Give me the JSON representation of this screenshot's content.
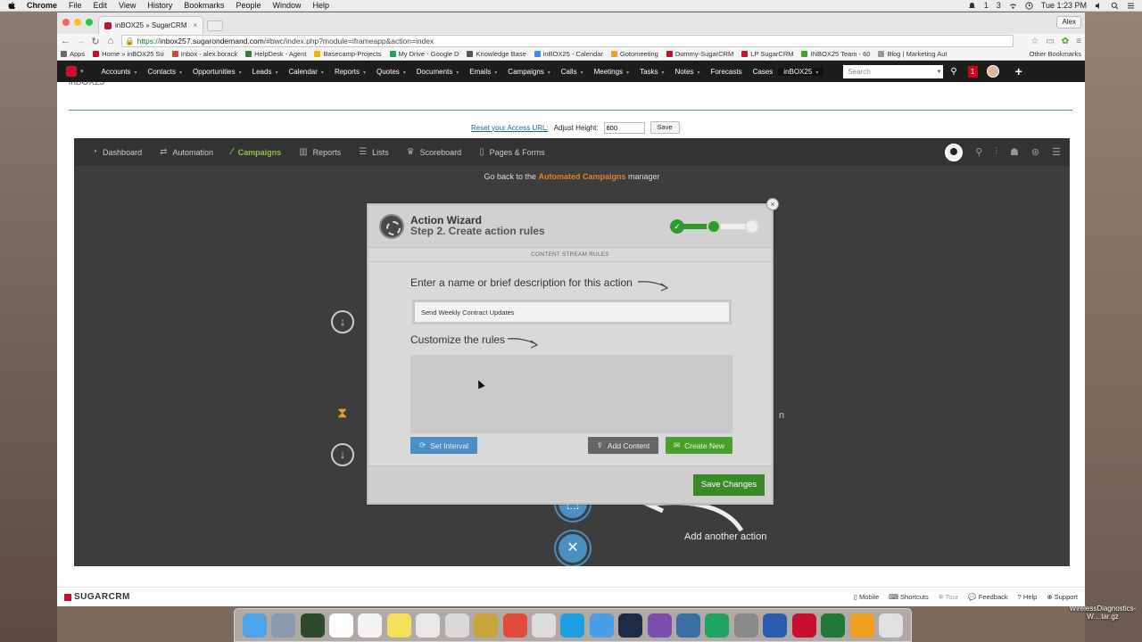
{
  "menubar": {
    "items": [
      "Chrome",
      "File",
      "Edit",
      "View",
      "History",
      "Bookmarks",
      "People",
      "Window",
      "Help"
    ],
    "battery_count": "1",
    "notif_count": "3",
    "clock": "Tue 1:23 PM"
  },
  "browser": {
    "tab_title": "inBOX25 » SugarCRM",
    "user": "Alex",
    "url_secure": "https://",
    "url_host": "inbox257.sugarondemand.com",
    "url_path": "/#bwc/index.php?module=iframeapp&action=index",
    "bookmarks": [
      {
        "label": "Apps",
        "color": "#6a6a6a"
      },
      {
        "label": "Home » inBOX25 Su",
        "color": "#c8102e"
      },
      {
        "label": "Inbox - alex.borack",
        "color": "#d44638"
      },
      {
        "label": "HelpDesk - Agent",
        "color": "#3a7a3a"
      },
      {
        "label": "Basecamp-Projects",
        "color": "#f5b400"
      },
      {
        "label": "My Drive - Google D",
        "color": "#1da462"
      },
      {
        "label": "Knowledge Base",
        "color": "#555555"
      },
      {
        "label": "inBOX25 - Calendar",
        "color": "#4285f4"
      },
      {
        "label": "Gotomeeting",
        "color": "#f4a020"
      },
      {
        "label": "Dummy-SugarCRM",
        "color": "#c8102e"
      },
      {
        "label": "LP SugarCRM",
        "color": "#c8102e"
      },
      {
        "label": "INBOX25 Team - 60",
        "color": "#4aa02c"
      },
      {
        "label": "Blog | Marketing Aut",
        "color": "#999999"
      }
    ],
    "other_bookmarks": "Other Bookmarks"
  },
  "sugar": {
    "nav": [
      "Accounts",
      "Contacts",
      "Opportunities",
      "Leads",
      "Calendar",
      "Reports",
      "Quotes",
      "Documents",
      "Emails",
      "Campaigns",
      "Calls",
      "Meetings",
      "Tasks",
      "Notes",
      "Forecasts",
      "Cases",
      "inBOX25"
    ],
    "search_placeholder": "Search",
    "notif_count": "1",
    "footer_brand": "SUGARCRM",
    "footer_links": [
      "Mobile",
      "Shortcuts",
      "Tour",
      "Feedback",
      "Help",
      "Support"
    ]
  },
  "page": {
    "clipped_title": "inBOX25",
    "reset_link": "Reset your Access URL:",
    "adjust_label": "Adjust Height:",
    "height_value": "800",
    "save_label": "Save"
  },
  "app": {
    "nav": [
      {
        "label": "Dashboard",
        "icon": "dashboard-icon"
      },
      {
        "label": "Automation",
        "icon": "shuffle-icon"
      },
      {
        "label": "Campaigns",
        "icon": "wand-icon",
        "active": true
      },
      {
        "label": "Reports",
        "icon": "bar-chart-icon"
      },
      {
        "label": "Lists",
        "icon": "list-icon"
      },
      {
        "label": "Scoreboard",
        "icon": "trophy-icon"
      },
      {
        "label": "Pages & Forms",
        "icon": "page-icon"
      }
    ],
    "goback_pre": "Go back to the",
    "goback_link": "Automated Campaigns",
    "goback_post": "manager",
    "add_another": "Add another action"
  },
  "wizard": {
    "title": "Action Wizard",
    "subtitle": "Step 2. Create action rules",
    "section": "CONTENT STREAM RULES",
    "name_label": "Enter a name or brief description for this action",
    "name_value": "Send Weekly Contract Updates",
    "rules_label": "Customize the rules",
    "btn_interval": "Set Interval",
    "btn_add_content": "Add Content",
    "btn_create_new": "Create New",
    "btn_save": "Save Changes",
    "step_current": 2,
    "step_total": 3,
    "colors": {
      "accent_green": "#4aa02c",
      "accent_blue": "#4a90c2",
      "accent_orange": "#e2812b"
    }
  },
  "desktop": {
    "file_label": "WirelessDiagnostics-W....tar.gz"
  }
}
